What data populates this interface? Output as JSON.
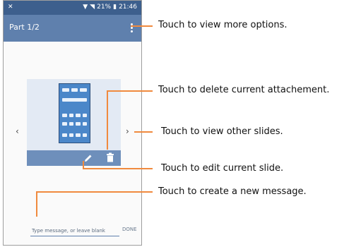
{
  "status_bar": {
    "time": "21:46",
    "battery": "21%"
  },
  "app_bar": {
    "title": "Part 1/2"
  },
  "composer": {
    "placeholder": "Type message, or leave blank",
    "done_label": "DONE"
  },
  "callouts": {
    "options": "Touch to view more options.",
    "delete": "Touch to delete current attachement.",
    "other_slides": "Touch to view other slides.",
    "edit": "Touch to edit current slide.",
    "new_message": "Touch to create a new message."
  },
  "colors": {
    "status_bar": "#3d5f8d",
    "app_bar": "#5f80ad",
    "leader": "#f08a3e"
  },
  "icons": [
    "menu-icon",
    "chevron-left-icon",
    "chevron-right-icon",
    "edit-icon",
    "delete-icon"
  ]
}
